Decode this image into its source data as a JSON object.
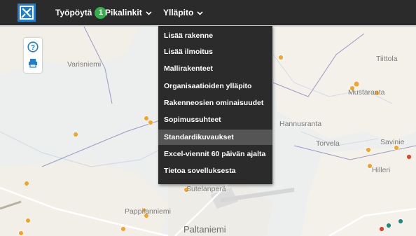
{
  "header": {
    "logo_icon": "x-logo-icon",
    "dashboard_label": "Työpöytä",
    "dashboard_badge": "1",
    "quicklinks_label": "Pikalinkit",
    "maintenance_label": "Ylläpito"
  },
  "map": {
    "tools": [
      {
        "icon": "help-icon"
      },
      {
        "icon": "print-icon"
      }
    ],
    "places": [
      "Varisniemi",
      "Tiittola",
      "Mustaranta",
      "Hannusranta",
      "Torvela",
      "Savinie",
      "Hilleri",
      "Sutelanperä",
      "Pappilanniemi",
      "Paltaniemi"
    ]
  },
  "menu": {
    "items": [
      {
        "label": "Lisää rakenne"
      },
      {
        "label": "Lisää ilmoitus"
      },
      {
        "label": "Mallirakenteet"
      },
      {
        "label": "Organisaatioiden ylläpito"
      },
      {
        "label": "Rakenneosien ominaisuudet"
      },
      {
        "label": "Sopimussuhteet"
      },
      {
        "label": "Standardikuvaukset"
      },
      {
        "label": "Excel-viennit 60 päivän ajalta"
      },
      {
        "label": "Tietoa sovelluksesta"
      }
    ],
    "active_item": "Standardikuvaukset"
  },
  "colors": {
    "header_bg": "#2b2b2b",
    "logo_blue": "#1f7ecb",
    "badge_green": "#34b04a",
    "marker_orange": "#f2a52a",
    "marker_red": "#e0432b",
    "marker_teal": "#1f8a7a"
  }
}
